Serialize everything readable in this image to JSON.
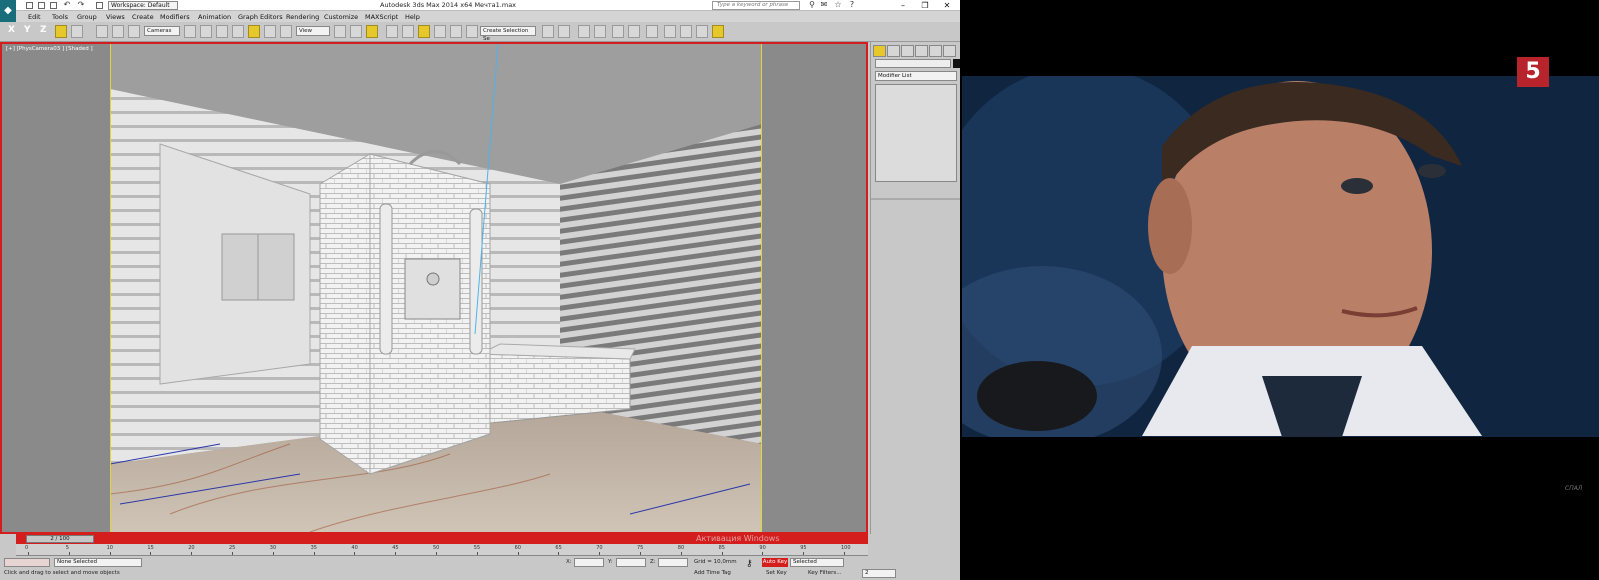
{
  "titlebar": {
    "workspace": "Workspace: Default",
    "title": "Autodesk 3ds Max 2014 x64    Мечта1.max",
    "search_placeholder": "Type a keyword or phrase"
  },
  "menu": [
    "Edit",
    "Tools",
    "Group",
    "Views",
    "Create",
    "Modifiers",
    "Animation",
    "Graph Editors",
    "Rendering",
    "Customize",
    "MAXScript",
    "Help"
  ],
  "toolbar": {
    "axes": [
      "X",
      "Y",
      "Z"
    ],
    "cameras_dropdown": "Cameras",
    "view_dropdown": "View",
    "selection_set": "Create Selection Se"
  },
  "viewport": {
    "label": "[+] [PhysCamera03 ] [Shaded ]"
  },
  "command_panel": {
    "modifier_list": "Modifier List"
  },
  "timeline": {
    "slider": "2 / 100",
    "activation": "Активация Windows",
    "ticks": [
      "0",
      "5",
      "10",
      "15",
      "20",
      "25",
      "30",
      "35",
      "40",
      "45",
      "50",
      "55",
      "60",
      "65",
      "70",
      "75",
      "80",
      "85",
      "90",
      "95",
      "100"
    ]
  },
  "status": {
    "selection": "None Selected",
    "prompt": "Click and drag to select and move objects",
    "x_label": "X:",
    "y_label": "Y:",
    "z_label": "Z:",
    "grid": "Grid = 10,0mm",
    "add_time_tag": "Add Time Tag",
    "auto_key": "Auto Key",
    "set_key": "Set Key",
    "selected": "Selected",
    "key_filters": "Key Filters...",
    "frame": "2"
  },
  "video": {
    "channel_logo": "5",
    "watermark": "СПАЛ"
  },
  "colors": {
    "viewport_border": "#d41e1e",
    "safe_frame": "#e6d23a",
    "auto_key": "#d41e1e",
    "channel_logo": "#b8242c"
  }
}
